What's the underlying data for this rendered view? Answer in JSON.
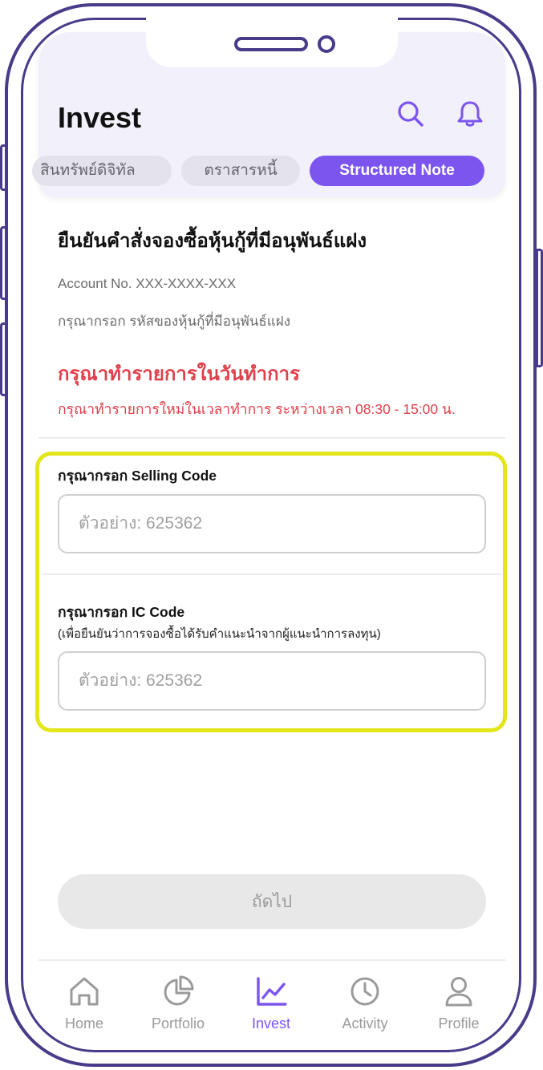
{
  "header": {
    "title": "Invest",
    "chips": [
      {
        "label": "สินทรัพย์ดิจิทัล",
        "active": false
      },
      {
        "label": "ตราสารหนี้",
        "active": false
      },
      {
        "label": "Structured Note",
        "active": true
      }
    ],
    "icons": [
      "search-icon",
      "bell-icon"
    ]
  },
  "content": {
    "title": "ยืนยันคำสั่งจองซื้อหุ้นกู้ที่มีอนุพันธ์แฝง",
    "account": "Account No. XXX-XXXX-XXX",
    "hint": "กรุณากรอก รหัสของหุ้นกู้ที่มีอนุพันธ์แฝง",
    "warning_title": "กรุณาทำรายการในวันทำการ",
    "warning_text": "กรุณาทำรายการใหม่ในเวลาทำการ ระหว่างเวลา 08:30 - 15:00 น."
  },
  "form": {
    "selling_label": "กรุณากรอก Selling Code",
    "selling_value": "",
    "selling_placeholder": "ตัวอย่าง: 625362",
    "ic_label": "กรุณากรอก IC Code",
    "ic_note": "(เพื่อยืนยันว่าการจองซื้อได้รับคำแนะนำจากผู้แนะนำการลงทุน)",
    "ic_value": "",
    "ic_placeholder": "ตัวอย่าง: 625362",
    "next_label": "ถัดไป"
  },
  "nav": {
    "items": [
      {
        "label": "Home",
        "icon": "home-icon",
        "active": false
      },
      {
        "label": "Portfolio",
        "icon": "pie-chart-icon",
        "active": false
      },
      {
        "label": "Invest",
        "icon": "trend-chart-icon",
        "active": true
      },
      {
        "label": "Activity",
        "icon": "clock-icon",
        "active": false
      },
      {
        "label": "Profile",
        "icon": "user-icon",
        "active": false
      }
    ]
  },
  "colors": {
    "accent": "#7b55ee",
    "frame": "#4a3a8a",
    "warning": "#e0404b",
    "highlight": "#e3e61a",
    "header_bg": "#f2f0fa"
  }
}
